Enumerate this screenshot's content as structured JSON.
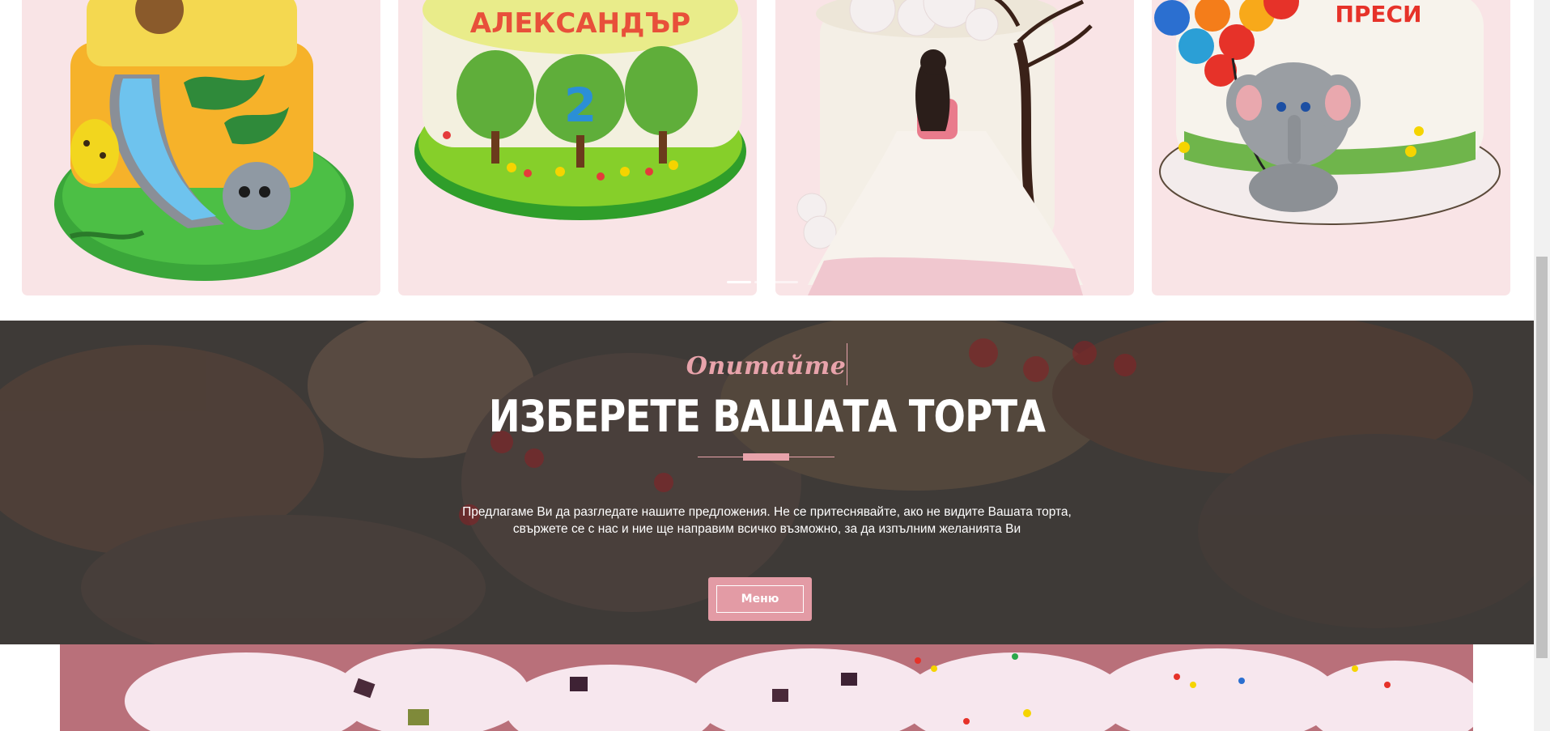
{
  "carousel": {
    "cards": [
      {
        "name": "jungle cake"
      },
      {
        "name": "forest cake",
        "cake_text": "АЛЕКСАНДЪР",
        "number_text": "2"
      },
      {
        "name": "princess cake"
      },
      {
        "name": "elephant balloon cake",
        "cake_text": "ПРЕСИ"
      }
    ],
    "dots_count": 3,
    "active_dot": 0
  },
  "hero": {
    "script_label": "Опитайте",
    "title": "ИЗБЕРЕТЕ ВАШАТА ТОРТА",
    "text_line1": "Предлагаме Ви да разгледате нашите предложения. Не се притеснявайте, ако не видите Вашата торта,",
    "text_line2": "свържете се с нас и ние ще направим всичко възможно, за да изпълним желанията Ви",
    "button_label": "Меню"
  },
  "colors": {
    "accent": "#e8a3ab",
    "card_background": "#f9e4e6",
    "hero_overlay": "#3d3a38"
  }
}
